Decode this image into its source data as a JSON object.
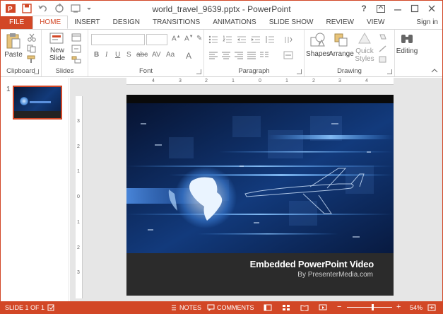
{
  "window": {
    "title": "world_travel_9639.pptx - PowerPoint"
  },
  "tabs": [
    "FILE",
    "HOME",
    "INSERT",
    "DESIGN",
    "TRANSITIONS",
    "ANIMATIONS",
    "SLIDE SHOW",
    "REVIEW",
    "VIEW"
  ],
  "account": {
    "signin": "Sign in"
  },
  "ribbon": {
    "clipboard": {
      "label": "Clipboard",
      "paste": "Paste"
    },
    "slides": {
      "label": "Slides",
      "new_slide_1": "New",
      "new_slide_2": "Slide"
    },
    "font": {
      "label": "Font"
    },
    "paragraph": {
      "label": "Paragraph"
    },
    "drawing": {
      "label": "Drawing",
      "shapes": "Shapes",
      "arrange": "Arrange",
      "quick_styles_1": "Quick",
      "quick_styles_2": "Styles"
    },
    "editing": {
      "label": "Editing"
    }
  },
  "thumbnail": {
    "number": "1"
  },
  "slide": {
    "title": "Embedded PowerPoint Video",
    "subtitle": "By PresenterMedia.com"
  },
  "rulers": {
    "horizontal": [
      "4",
      "3",
      "2",
      "1",
      "0",
      "1",
      "2",
      "3",
      "4"
    ],
    "vertical": [
      "3",
      "2",
      "1",
      "0",
      "1",
      "2",
      "3"
    ]
  },
  "status": {
    "slide_info": "SLIDE 1 OF 1",
    "notes": "NOTES",
    "comments": "COMMENTS",
    "zoom": "54%",
    "zoom_level": 0.54
  },
  "colors": {
    "accent": "#d24726",
    "slide_bg": "#0b1530",
    "slide_footer": "#2b2b2b"
  },
  "icons": [
    "powerpoint-app-icon",
    "save-icon",
    "undo-icon",
    "redo-icon",
    "start-from-beginning-icon",
    "help-icon",
    "ribbon-display-icon",
    "minimize-icon",
    "maximize-icon",
    "close-icon"
  ]
}
